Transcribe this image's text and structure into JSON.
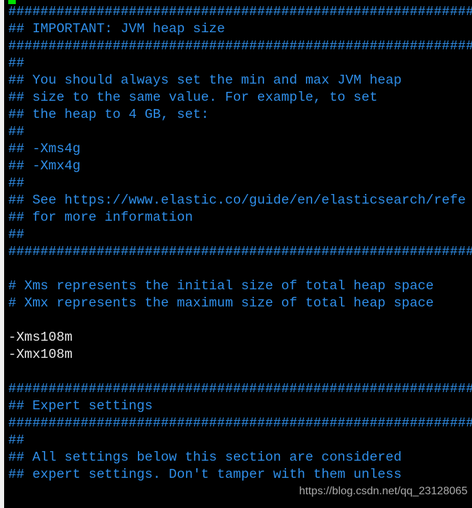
{
  "colors": {
    "comment": "#2f8ee8",
    "text": "#e8e8e8",
    "cursor": "#00e000",
    "background": "#000000"
  },
  "lines": [
    {
      "text": "",
      "kind": "c"
    },
    {
      "text": "################################################################",
      "kind": "c"
    },
    {
      "text": "## IMPORTANT: JVM heap size",
      "kind": "c"
    },
    {
      "text": "################################################################",
      "kind": "c"
    },
    {
      "text": "##",
      "kind": "c"
    },
    {
      "text": "## You should always set the min and max JVM heap",
      "kind": "c"
    },
    {
      "text": "## size to the same value. For example, to set",
      "kind": "c"
    },
    {
      "text": "## the heap to 4 GB, set:",
      "kind": "c"
    },
    {
      "text": "##",
      "kind": "c"
    },
    {
      "text": "## -Xms4g",
      "kind": "c"
    },
    {
      "text": "## -Xmx4g",
      "kind": "c"
    },
    {
      "text": "##",
      "kind": "c"
    },
    {
      "text": "## See https://www.elastic.co/guide/en/elasticsearch/refe",
      "kind": "c"
    },
    {
      "text": "## for more information",
      "kind": "c"
    },
    {
      "text": "##",
      "kind": "c"
    },
    {
      "text": "################################################################",
      "kind": "c"
    },
    {
      "text": "",
      "kind": "c"
    },
    {
      "text": "# Xms represents the initial size of total heap space",
      "kind": "c"
    },
    {
      "text": "# Xmx represents the maximum size of total heap space",
      "kind": "c"
    },
    {
      "text": "",
      "kind": "c"
    },
    {
      "text": "-Xms108m",
      "kind": "w"
    },
    {
      "text": "-Xmx108m",
      "kind": "w"
    },
    {
      "text": "",
      "kind": "c"
    },
    {
      "text": "################################################################",
      "kind": "c"
    },
    {
      "text": "## Expert settings",
      "kind": "c"
    },
    {
      "text": "################################################################",
      "kind": "c"
    },
    {
      "text": "##",
      "kind": "c"
    },
    {
      "text": "## All settings below this section are considered",
      "kind": "c"
    },
    {
      "text": "## expert settings. Don't tamper with them unless",
      "kind": "c"
    }
  ],
  "watermark": "https://blog.csdn.net/qq_23128065"
}
